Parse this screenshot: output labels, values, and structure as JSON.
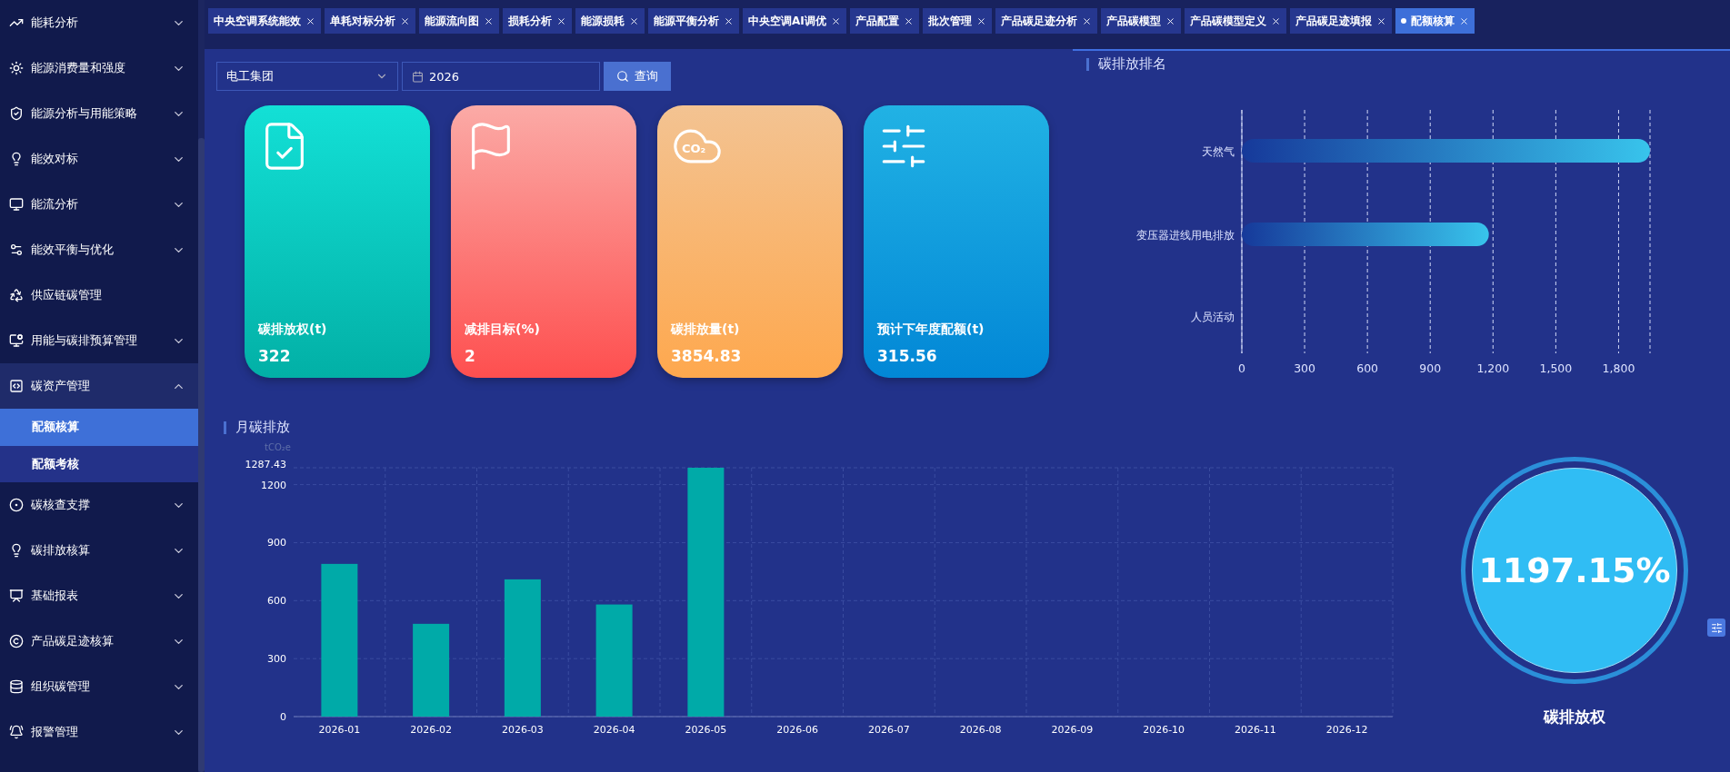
{
  "sidebar": {
    "items": [
      {
        "label": "能耗分析",
        "kind": "group",
        "expanded": false
      },
      {
        "label": "能源消费量和强度",
        "kind": "group",
        "expanded": false
      },
      {
        "label": "能源分析与用能策略",
        "kind": "group",
        "expanded": false
      },
      {
        "label": "能效对标",
        "kind": "group",
        "expanded": false
      },
      {
        "label": "能流分析",
        "kind": "group",
        "expanded": false
      },
      {
        "label": "能效平衡与优化",
        "kind": "group",
        "expanded": false
      },
      {
        "label": "供应链碳管理",
        "kind": "link",
        "expanded": false
      },
      {
        "label": "用能与碳排预算管理",
        "kind": "group",
        "expanded": false
      },
      {
        "label": "碳资产管理",
        "kind": "group",
        "expanded": true,
        "children": [
          {
            "label": "配额核算",
            "selected": true
          },
          {
            "label": "配额考核",
            "selected": false
          }
        ]
      },
      {
        "label": "碳核查支撑",
        "kind": "group",
        "expanded": false
      },
      {
        "label": "碳排放核算",
        "kind": "group",
        "expanded": false
      },
      {
        "label": "基础报表",
        "kind": "group",
        "expanded": false
      },
      {
        "label": "产品碳足迹核算",
        "kind": "group",
        "expanded": false
      },
      {
        "label": "组织碳管理",
        "kind": "group",
        "expanded": false
      },
      {
        "label": "报警管理",
        "kind": "group",
        "expanded": false
      }
    ]
  },
  "tabs": [
    {
      "label": "中央空调系统能效",
      "selected": false
    },
    {
      "label": "单耗对标分析",
      "selected": false
    },
    {
      "label": "能源流向图",
      "selected": false
    },
    {
      "label": "损耗分析",
      "selected": false
    },
    {
      "label": "能源损耗",
      "selected": false
    },
    {
      "label": "能源平衡分析",
      "selected": false
    },
    {
      "label": "中央空调AI调优",
      "selected": false
    },
    {
      "label": "产品配置",
      "selected": false
    },
    {
      "label": "批次管理",
      "selected": false
    },
    {
      "label": "产品碳足迹分析",
      "selected": false
    },
    {
      "label": "产品碳模型",
      "selected": false
    },
    {
      "label": "产品碳模型定义",
      "selected": false
    },
    {
      "label": "产品碳足迹填报",
      "selected": false
    },
    {
      "label": "配额核算",
      "selected": true
    }
  ],
  "filters": {
    "company": "电工集团",
    "year": "2026",
    "search_button": "查询"
  },
  "cards": [
    {
      "title": "碳排放权(t)",
      "value": "322"
    },
    {
      "title": "减排目标(%)",
      "value": "2"
    },
    {
      "title": "碳排放量(t)",
      "value": "3854.83",
      "icon_label": "CO₂"
    },
    {
      "title": "预计下年度配额(t)",
      "value": "315.56"
    }
  ],
  "ranking": {
    "chart_data": {
      "type": "bar",
      "orientation": "horizontal",
      "grid": true,
      "title": "碳排放排名",
      "categories": [
        "天然气",
        "变压器进线用电排放",
        "人员活动"
      ],
      "values": [
        1950,
        1180,
        0
      ],
      "xlim": [
        0,
        1950
      ],
      "xticks": [
        0,
        300,
        600,
        900,
        {
          "value": 1200,
          "label": "1,200"
        },
        {
          "value": 1500,
          "label": "1,500"
        },
        {
          "value": 1800,
          "label": "1,800"
        }
      ]
    }
  },
  "monthly": {
    "chart_data": {
      "type": "bar",
      "orientation": "vertical",
      "grid": true,
      "title": "月碳排放",
      "ylabel": "tCO₂e",
      "categories": [
        "2026-01",
        "2026-02",
        "2026-03",
        "2026-04",
        "2026-05",
        "2026-06",
        "2026-07",
        "2026-08",
        "2026-09",
        "2026-10",
        "2026-11",
        "2026-12"
      ],
      "values": [
        790,
        480,
        710,
        580,
        1287.43,
        null,
        null,
        null,
        null,
        null,
        null,
        null
      ],
      "ylim": [
        0,
        1287.43
      ],
      "yticks": [
        0,
        300,
        600,
        900,
        1200,
        1287.43
      ]
    }
  },
  "gauge": {
    "value": "1197.15%",
    "label": "碳排放权"
  }
}
